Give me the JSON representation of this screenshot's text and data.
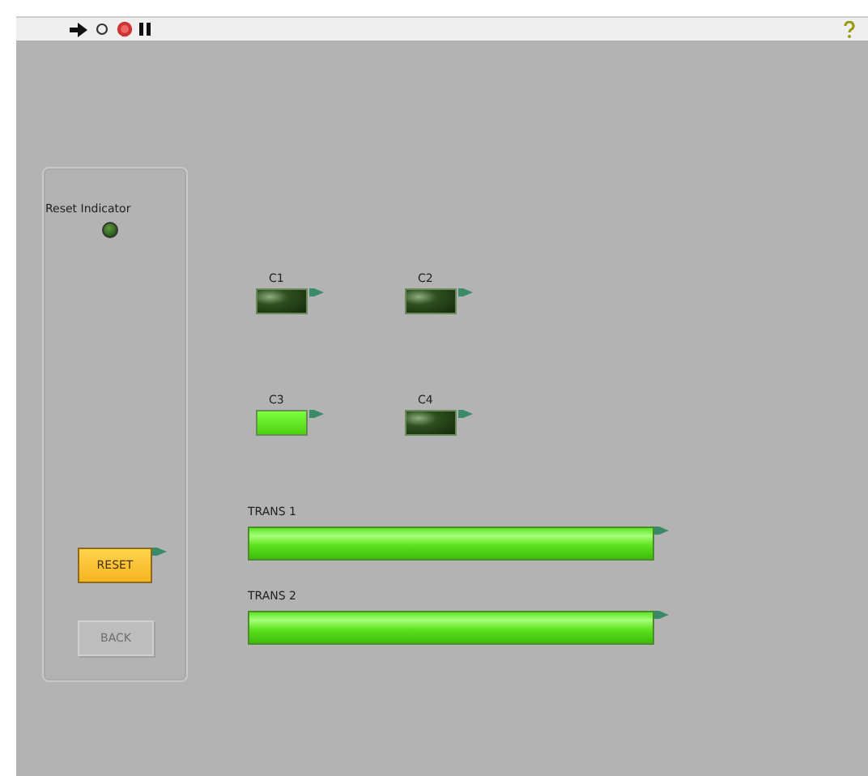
{
  "reset_indicator": {
    "label": "Reset Indicator",
    "on": false
  },
  "leds": [
    {
      "label": "C1",
      "on": false
    },
    {
      "label": "C2",
      "on": false
    },
    {
      "label": "C3",
      "on": true
    },
    {
      "label": "C4",
      "on": false
    }
  ],
  "bars": [
    {
      "label": "TRANS 1",
      "on": true
    },
    {
      "label": "TRANS 2",
      "on": true
    }
  ],
  "buttons": [
    {
      "label": "RESET",
      "disabled": false
    },
    {
      "label": "BACK",
      "disabled": true
    }
  ]
}
